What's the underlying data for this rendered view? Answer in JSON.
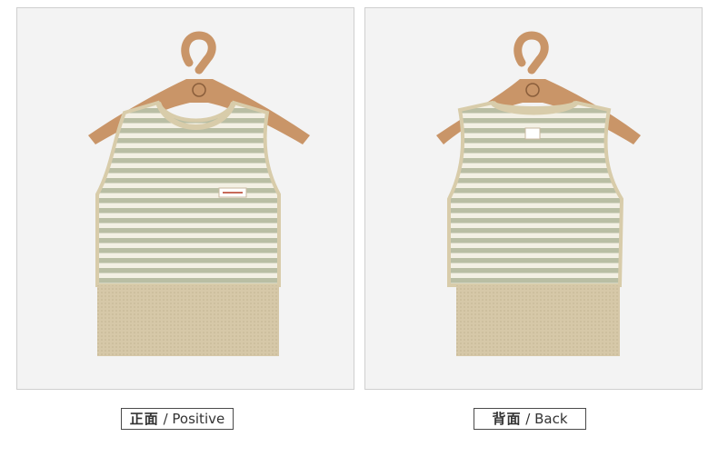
{
  "views": [
    {
      "label_cn": "正面",
      "label_sep": " / ",
      "label_en": "Positive"
    },
    {
      "label_cn": "背面",
      "label_sep": " / ",
      "label_en": "Back"
    }
  ],
  "colors": {
    "panel_bg": "#f3f3f3",
    "panel_border": "#cfcfcf",
    "stripe_green": "#b9bea4",
    "stripe_cream": "#f3f0e4",
    "trim_khaki": "#d8ccaa",
    "hem_beige": "#d6c8a8",
    "hanger_wood": "#c99568"
  }
}
